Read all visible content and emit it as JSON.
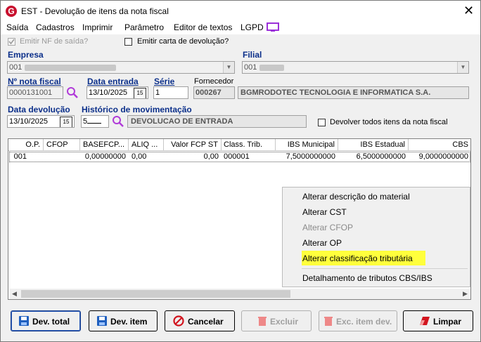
{
  "window": {
    "title": "EST - Devolução de itens da nota fiscal"
  },
  "menu": {
    "items": [
      "Saída",
      "Cadastros",
      "Imprimir",
      "Parâmetro",
      "Editor de textos",
      "LGPD"
    ]
  },
  "options": {
    "emitir_nf": "Emitir NF de saída?",
    "emitir_nf_checked": true,
    "emitir_carta": "Emitir carta de devolução?",
    "devolver_todos": "Devolver todos itens da nota fiscal"
  },
  "form": {
    "empresa_label": "Empresa",
    "empresa_value": "001",
    "filial_label": "Filial",
    "filial_value": "001",
    "nota_label": "Nº nota fiscal",
    "nota_value": "0000131001",
    "entrada_label": "Data entrada",
    "entrada_value": "13/10/2025",
    "serie_label": "Série",
    "serie_value": "1",
    "fornecedor_label": "Fornecedor",
    "fornecedor_code": "000267",
    "fornecedor_name": "BGMRODOTEC TECNOLOGIA E INFORMATICA S.A.",
    "devolucao_label": "Data devolução",
    "devolucao_value": "13/10/2025",
    "historico_label": "Histórico de movimentação",
    "historico_code": "5",
    "historico_desc": "DEVOLUCAO DE ENTRADA"
  },
  "grid": {
    "columns": [
      "O.P.",
      "CFOP",
      "BASEFCP...",
      "ALIQ ...",
      "Valor FCP ST",
      "Class. Trib.",
      "IBS Municipal",
      "IBS Estadual",
      "CBS"
    ],
    "rows": [
      [
        "001",
        "",
        "0,00000000",
        "0,00",
        "0,00",
        "000001",
        "7,5000000000",
        "6,5000000000",
        "9,0000000000"
      ]
    ]
  },
  "context_menu": {
    "items": [
      {
        "label": "Alterar descrição do material",
        "enabled": true
      },
      {
        "label": "Alterar CST",
        "enabled": true
      },
      {
        "label": "Alterar CFOP",
        "enabled": false
      },
      {
        "label": "Alterar OP",
        "enabled": true
      },
      {
        "label": "Alterar classificação tributária",
        "enabled": true,
        "highlighted": true
      },
      {
        "label": "Detalhamento de tributos CBS/IBS",
        "enabled": true
      }
    ],
    "highlight_color": "#ffff3c"
  },
  "buttons": {
    "dev_total": "Dev. total",
    "dev_item": "Dev. item",
    "cancelar": "Cancelar",
    "excluir": "Excluir",
    "exc_item": "Exc. item dev.",
    "limpar": "Limpar"
  },
  "colors": {
    "label_blue": "#0b2f8a",
    "brand_red": "#c8102e",
    "lgpd_purple": "#9b30d9",
    "search_purple": "#b03ad8"
  }
}
